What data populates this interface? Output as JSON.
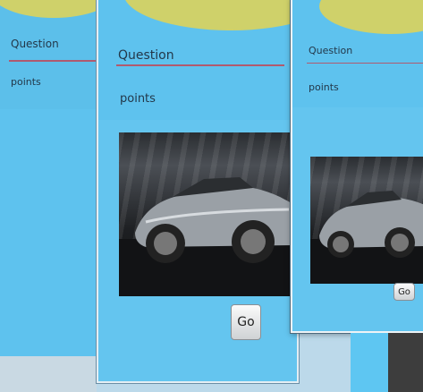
{
  "windows": [
    {
      "question_label": "Question",
      "points_label": "points"
    },
    {
      "question_label": "Question",
      "points_label": "points",
      "go_label": "Go"
    },
    {
      "question_label": "Question",
      "points_label": "points",
      "go_label": "Go"
    }
  ],
  "colors": {
    "panel_blue": "#5ec2ee",
    "wave_yellow": "#cfd16a",
    "underline": "#b05a6f"
  }
}
